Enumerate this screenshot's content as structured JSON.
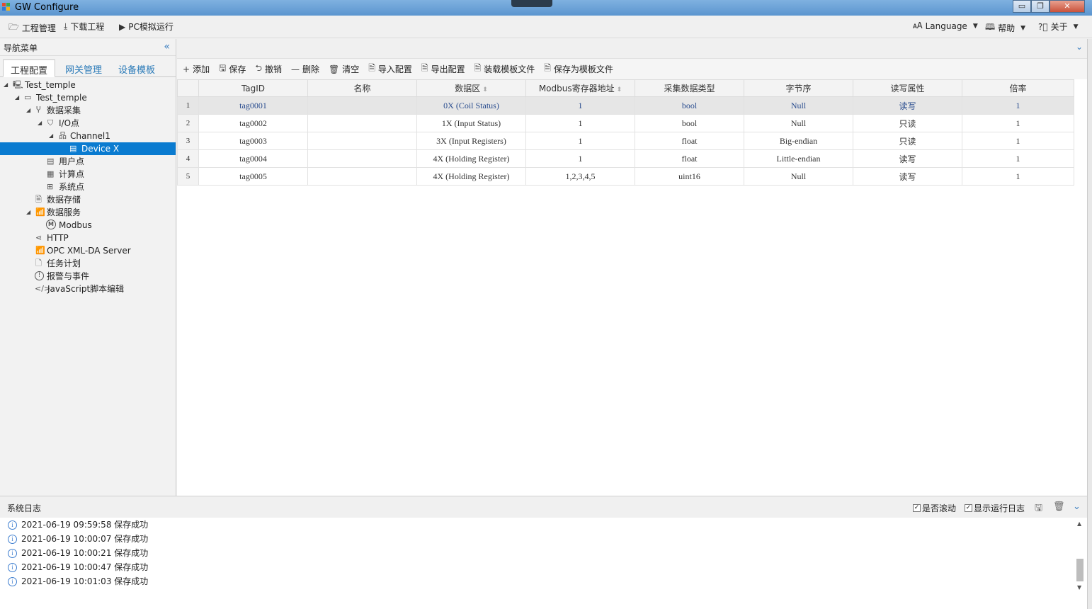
{
  "window": {
    "title": "GW Configure",
    "min": "▭",
    "max": "❐",
    "close": "✕"
  },
  "menu": {
    "project": "工程管理",
    "download": "下载工程",
    "simulate": "PC模拟运行",
    "language": "Language",
    "help": "帮助",
    "about": "关于"
  },
  "nav": {
    "title": "导航菜单",
    "tabs": [
      "工程配置",
      "网关管理",
      "设备模板"
    ],
    "tree": [
      {
        "label": "Test_temple"
      },
      {
        "label": "Test_temple"
      },
      {
        "label": "数据采集"
      },
      {
        "label": "I/O点"
      },
      {
        "label": "Channel1"
      },
      {
        "label": "Device X"
      },
      {
        "label": "用户点"
      },
      {
        "label": "计算点"
      },
      {
        "label": "系统点"
      },
      {
        "label": "数据存储"
      },
      {
        "label": "数据服务"
      },
      {
        "label": "Modbus"
      },
      {
        "label": "HTTP"
      },
      {
        "label": "OPC XML-DA Server"
      },
      {
        "label": "任务计划"
      },
      {
        "label": "报警与事件"
      },
      {
        "label": "JavaScript脚本编辑"
      }
    ]
  },
  "toolbar": {
    "add": "添加",
    "save": "保存",
    "undo": "撤销",
    "delete": "删除",
    "clear": "清空",
    "import": "导入配置",
    "export": "导出配置",
    "load_template": "装载模板文件",
    "save_template": "保存为模板文件"
  },
  "table": {
    "headers": [
      "TagID",
      "名称",
      "数据区",
      "Modbus寄存器地址",
      "采集数据类型",
      "字节序",
      "读写属性",
      "倍率"
    ],
    "rows": [
      {
        "n": "1",
        "cells": [
          "tag0001",
          "",
          "0X (Coil Status)",
          "1",
          "bool",
          "Null",
          "读写",
          "1"
        ]
      },
      {
        "n": "2",
        "cells": [
          "tag0002",
          "",
          "1X (Input Status)",
          "1",
          "bool",
          "Null",
          "只读",
          "1"
        ]
      },
      {
        "n": "3",
        "cells": [
          "tag0003",
          "",
          "3X (Input Registers)",
          "1",
          "float",
          "Big-endian",
          "只读",
          "1"
        ]
      },
      {
        "n": "4",
        "cells": [
          "tag0004",
          "",
          "4X (Holding Register)",
          "1",
          "float",
          "Little-endian",
          "读写",
          "1"
        ]
      },
      {
        "n": "5",
        "cells": [
          "tag0005",
          "",
          "4X (Holding Register)",
          "1,2,3,4,5",
          "uint16",
          "Null",
          "读写",
          "1"
        ]
      }
    ]
  },
  "log": {
    "title": "系统日志",
    "autoscroll": "是否滚动",
    "show_runtime": "显示运行日志",
    "entries": [
      "2021-06-19 09:59:58 保存成功",
      "2021-06-19 10:00:07 保存成功",
      "2021-06-19 10:00:21 保存成功",
      "2021-06-19 10:00:47 保存成功",
      "2021-06-19 10:01:03 保存成功"
    ]
  }
}
